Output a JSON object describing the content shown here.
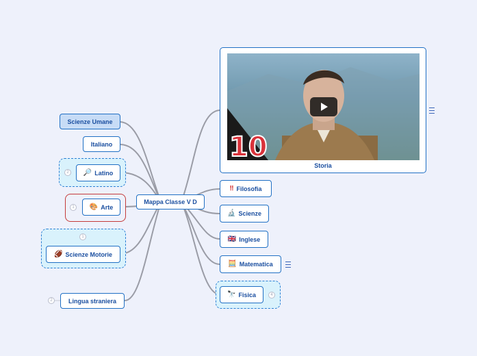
{
  "map": {
    "root": "Mappa Classe V D",
    "left_nodes": [
      {
        "label": "Scienze Umane"
      },
      {
        "label": "Italiano"
      },
      {
        "label": "Latino",
        "icon": "magnifier-icon",
        "glyph": "🔎",
        "count": "2"
      },
      {
        "label": "Arte",
        "icon": "palette-icon",
        "glyph": "🎨",
        "count": "1"
      },
      {
        "label": "Scienze Motorie",
        "icon": "football-icon",
        "glyph": "🏈",
        "count": "1"
      },
      {
        "label": "Lingua straniera",
        "count": "2"
      }
    ],
    "right_nodes": [
      {
        "label": "Storia",
        "media": "video-thumbnail"
      },
      {
        "label": "Filosofia",
        "icon": "double-exclamation-icon",
        "glyph": "‼"
      },
      {
        "label": "Scienze",
        "icon": "microscope-icon",
        "glyph": "🔬"
      },
      {
        "label": "Inglese",
        "icon": "uk-flag-icon",
        "glyph": "🇬🇧"
      },
      {
        "label": "Matematica",
        "icon": "calculator-icon",
        "glyph": "🧮"
      },
      {
        "label": "Fisica",
        "icon": "physics-icon",
        "glyph": "🔭",
        "count": "4"
      }
    ],
    "video_overlay_number": "10"
  },
  "colors": {
    "background": "#eef1fb",
    "node_border": "#1f6fc4",
    "node_text": "#1b4fa0",
    "selected_fill": "#c7dcf6",
    "group_fill": "#d9f2fc",
    "connector": "#9a9ca6",
    "arte_border": "#c43a3a"
  }
}
